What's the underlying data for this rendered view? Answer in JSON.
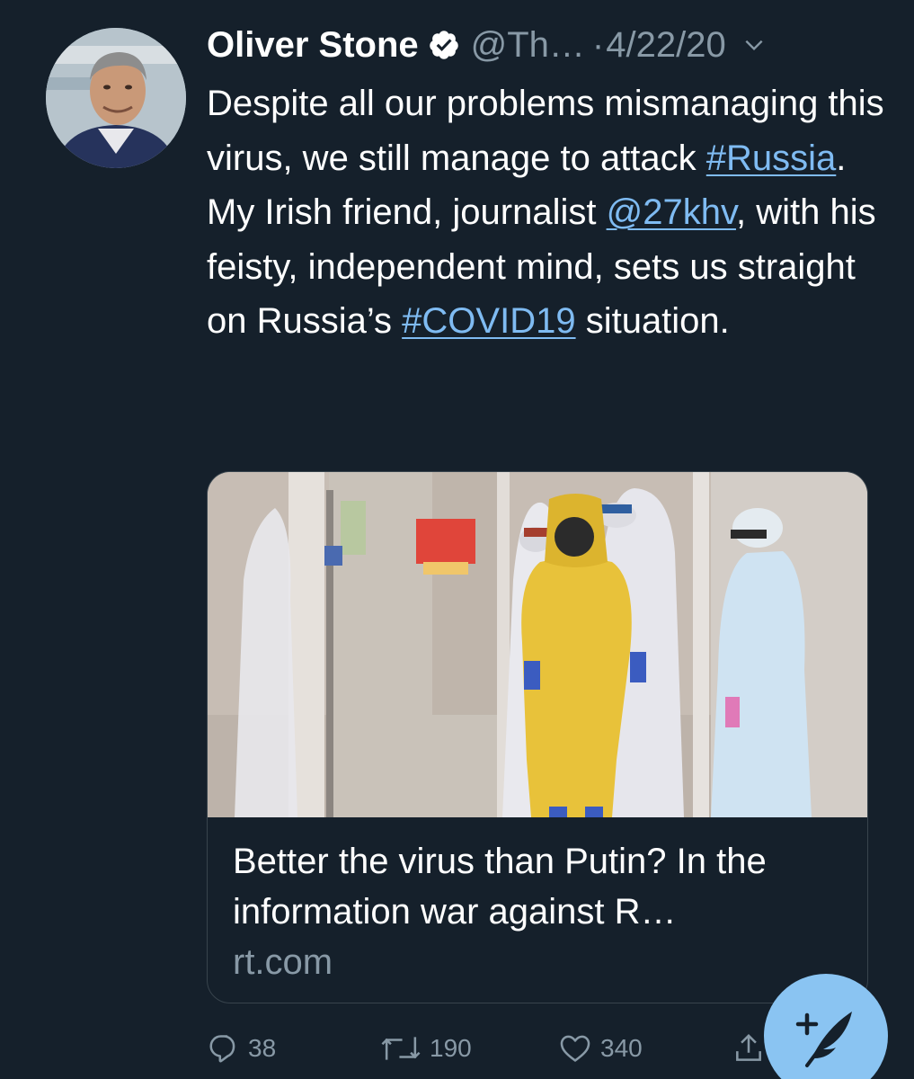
{
  "tweet": {
    "author_name": "Oliver Stone",
    "handle": "@Th…",
    "separator": "·",
    "date": "4/22/20",
    "text_parts": [
      "Despite all our problems mismanaging this virus, we still manage to attack ",
      "#Russia",
      ". My Irish friend, journalist ",
      "@27khv",
      ", with his feisty, independent mind, sets us straight on Russia’s ",
      "#COVID19",
      " situation."
    ],
    "card": {
      "title": "Better the virus than Putin? In the information war against R…",
      "domain": "rt.com"
    },
    "actions": {
      "replies": "38",
      "retweets": "190",
      "likes": "340"
    }
  },
  "colors": {
    "background": "#15202b",
    "link": "#7fbbf2",
    "secondary_text": "#8899a6",
    "fab": "#8ac4f2",
    "verified_badge": "#ffffff"
  },
  "icons": {
    "verified": "verified-badge-icon",
    "caret": "chevron-down-icon",
    "reply": "reply-icon",
    "retweet": "retweet-icon",
    "like": "heart-icon",
    "share": "share-icon",
    "compose": "compose-feather-icon"
  }
}
